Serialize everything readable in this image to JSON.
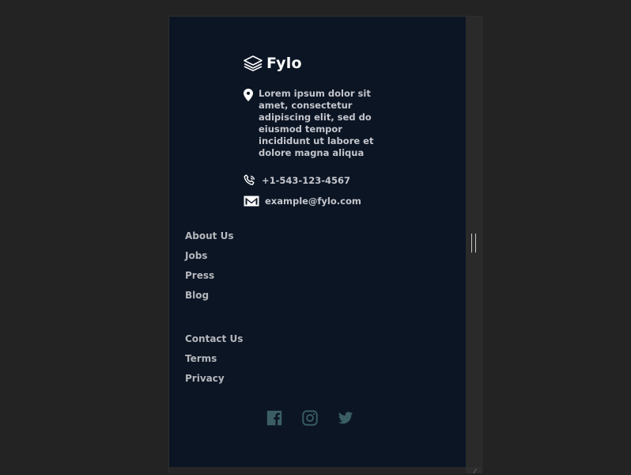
{
  "footer": {
    "brand": "Fylo",
    "address": "Lorem ipsum dolor sit amet, consectetur adipiscing elit, sed do eiusmod tempor incididunt ut labore et dolore magna aliqua",
    "phone": "+1-543-123-4567",
    "email": "example@fylo.com",
    "links_group_1": [
      "About Us",
      "Jobs",
      "Press",
      "Blog"
    ],
    "links_group_2": [
      "Contact Us",
      "Terms",
      "Privacy"
    ],
    "social": [
      {
        "name": "facebook-icon"
      },
      {
        "name": "instagram-icon"
      },
      {
        "name": "twitter-icon"
      }
    ]
  },
  "icons": {
    "logo": "layers-icon",
    "address": "location-pin-icon",
    "phone": "phone-icon",
    "email": "email-icon"
  },
  "colors": {
    "page_background": "#0c1524",
    "outer_background": "#232323",
    "text": "#c4c6cc",
    "social_icon": "#3a5e64"
  }
}
